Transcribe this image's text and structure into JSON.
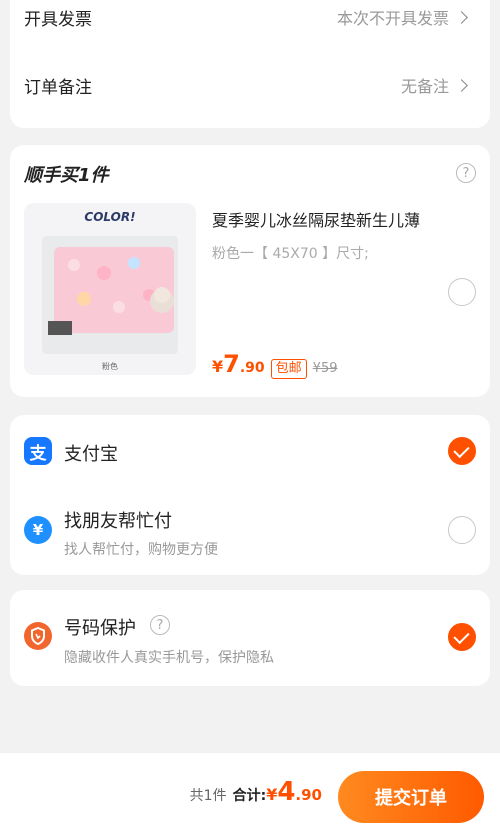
{
  "settings": {
    "invoice": {
      "label": "开具发票",
      "value": "本次不开具发票"
    },
    "remark": {
      "label": "订单备注",
      "value": "无备注"
    }
  },
  "addon": {
    "title": "顺手买1件",
    "product": {
      "name": "夏季婴儿冰丝隔尿垫新生儿薄",
      "spec": "粉色一【 45X70 】尺寸;",
      "image_brand": "COLOR!",
      "image_caption": "粉色",
      "price_symbol": "¥",
      "price_int": "7",
      "price_dec": ".90",
      "shipping_tag": "包邮",
      "original_price": "¥59",
      "selected": false
    }
  },
  "payment": {
    "methods": [
      {
        "name": "支付宝",
        "icon": "alipay-icon",
        "icon_glyph": "支",
        "color": "#1677ff",
        "selected": true
      },
      {
        "name": "找朋友帮忙付",
        "sub": "找人帮忙付，购物更方便",
        "icon": "friend-pay-icon",
        "icon_glyph": "¥",
        "color": "#1e90ff",
        "selected": false
      }
    ]
  },
  "privacy": {
    "name": "号码保护",
    "sub": "隐藏收件人真实手机号，保护隐私",
    "icon": "shield-phone-icon",
    "color": "#f0662d",
    "selected": true
  },
  "bottom": {
    "count": "共1件",
    "total_label": "合计:",
    "total_symbol": "¥",
    "total_int": "4",
    "total_dec": ".90",
    "submit": "提交订单"
  },
  "colors": {
    "accent": "#ff5000",
    "background": "#f2f2f2"
  }
}
